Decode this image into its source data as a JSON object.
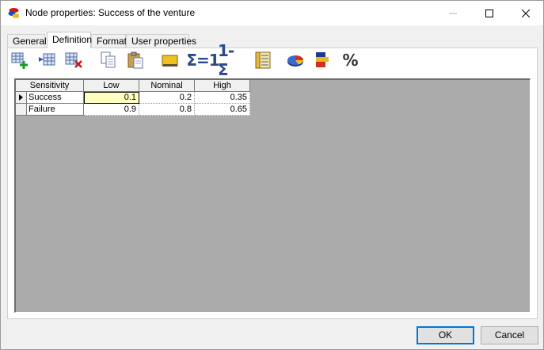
{
  "window": {
    "title": "Node properties: Success of the venture"
  },
  "tabs": [
    {
      "label": "General"
    },
    {
      "label": "Definition"
    },
    {
      "label": "Format"
    },
    {
      "label": "User properties"
    }
  ],
  "toolbar": {
    "sum_to_one_label": "Σ=1",
    "one_minus_sum_label": "1-Σ",
    "percent_label": "%"
  },
  "grid": {
    "corner_header": "Sensitivity",
    "columns": [
      "Low",
      "Nominal",
      "High"
    ],
    "rows": [
      {
        "label": "Success",
        "values": [
          "0.1",
          "0.2",
          "0.35"
        ]
      },
      {
        "label": "Failure",
        "values": [
          "0.9",
          "0.8",
          "0.65"
        ]
      }
    ]
  },
  "buttons": {
    "ok": "OK",
    "cancel": "Cancel"
  },
  "colors": {
    "selected_cell": "#ffffc0",
    "default_button_border": "#0078d7"
  }
}
